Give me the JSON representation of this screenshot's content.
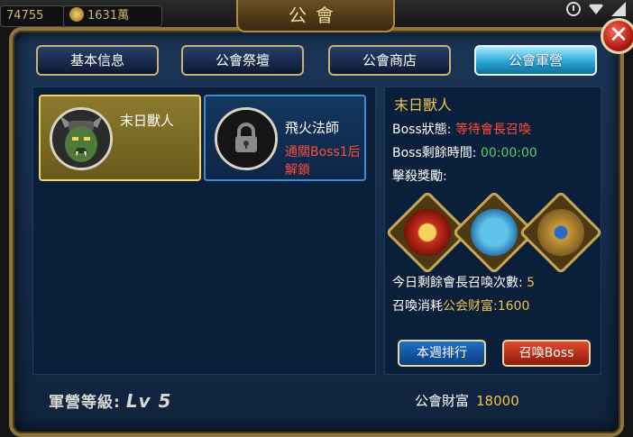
{
  "hud": {
    "left_value": "74755",
    "coins": "1631萬"
  },
  "window": {
    "title": "公會"
  },
  "tabs": [
    {
      "label": "基本信息",
      "active": false
    },
    {
      "label": "公會祭壇",
      "active": false
    },
    {
      "label": "公會商店",
      "active": false
    },
    {
      "label": "公會軍營",
      "active": true
    }
  ],
  "bosses": [
    {
      "name": "末日獸人",
      "selected": true,
      "locked": false,
      "portrait_icon": "orc-portrait-icon"
    },
    {
      "name": "飛火法師",
      "selected": false,
      "locked": true,
      "unlock_condition": "通關Boss1后解鎖",
      "portrait_icon": "padlock-icon"
    }
  ],
  "detail": {
    "boss_name": "末日獸人",
    "status_label": "Boss狀態:",
    "status_value": "等待會長召喚",
    "time_label": "Boss剩餘時間:",
    "time_value": "00:00:00",
    "rewards_label": "擊殺獎勵:",
    "rewards": [
      {
        "icon": "red-medal-icon"
      },
      {
        "icon": "gift-box-icon"
      },
      {
        "icon": "treasure-bag-icon"
      }
    ],
    "summon_count_label": "今日剩餘會長召喚次數:",
    "summon_count_value": "5",
    "cost_label": "召喚消耗",
    "cost_currency": "公会财富",
    "cost_value": ":1600",
    "rank_button": "本週排行",
    "summon_button": "召喚Boss"
  },
  "footer": {
    "camp_level_label": "軍營等級:",
    "camp_level_value": "Lv 5",
    "wealth_label": "公會財富",
    "wealth_value": "18000"
  },
  "colors": {
    "accent_gold": "#f3c24a",
    "warning_red": "#ff4d3a",
    "timer_green": "#4fd26a",
    "active_tab": "#2aa7d9"
  }
}
